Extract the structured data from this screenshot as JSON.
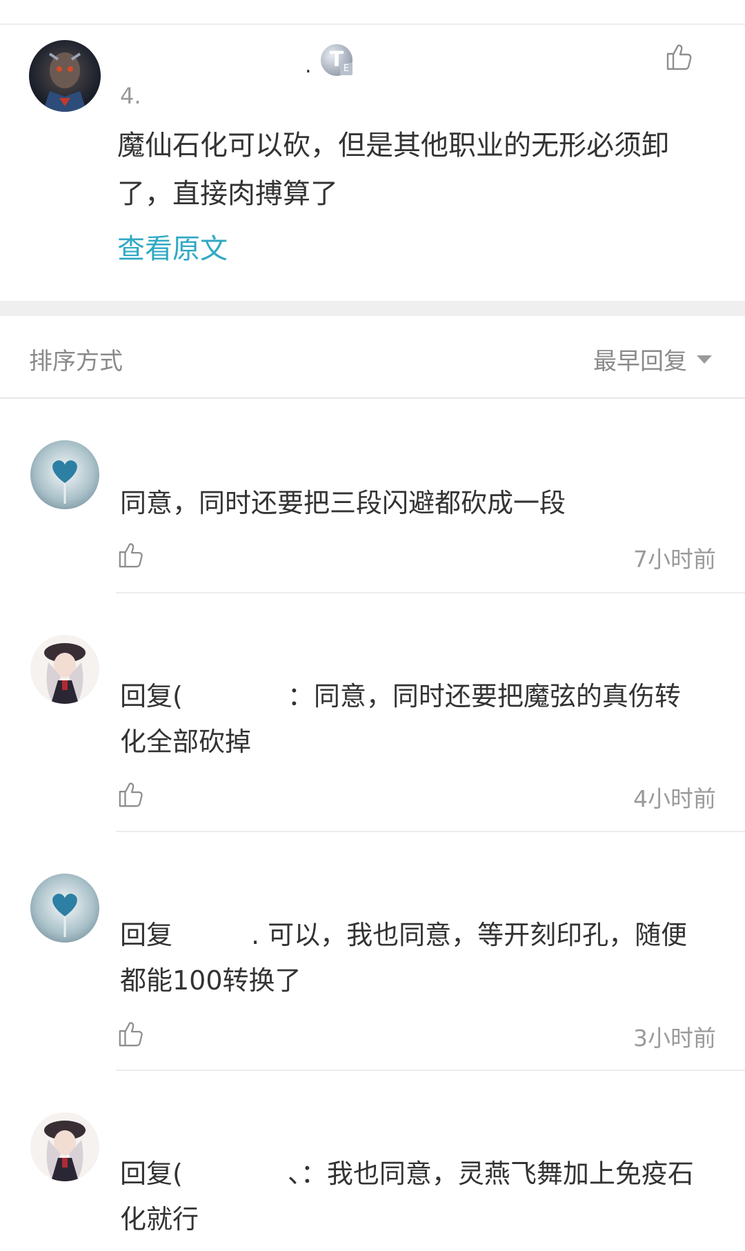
{
  "post": {
    "author_name": "",
    "level_badge": "T",
    "level_sub": "E",
    "meta": "4.",
    "body": "魔仙石化可以砍，但是其他职业的无形必须卸了，直接肉搏算了",
    "view_original": "查看原文"
  },
  "sort": {
    "label": "排序方式",
    "selected": "最早回复"
  },
  "replies": [
    {
      "text": "同意，同时还要把三段闪避都砍成一段",
      "time": "7小时前"
    },
    {
      "text": "回复(　　　　：同意，同时还要把魔弦的真伤转化全部砍掉",
      "time": "4小时前"
    },
    {
      "text": "回复　　　. 可以，我也同意，等开刻印孔，随便都能100转换了",
      "time": "3小时前"
    },
    {
      "text": "回复(　　　　、：我也同意，灵燕飞舞加上免疫石化就行",
      "time": ""
    }
  ],
  "icons": {
    "like": "thumbs-up-icon",
    "sort_caret": "caret-down-icon"
  },
  "colors": {
    "link": "#2fa9c4",
    "muted": "#9a9a9a",
    "divider": "#ececec"
  }
}
